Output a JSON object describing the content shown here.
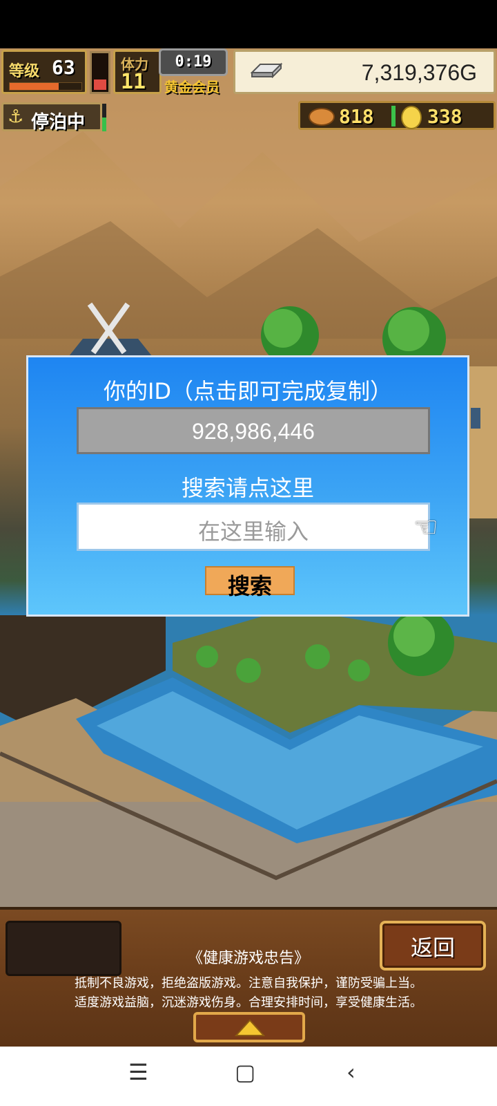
{
  "hud": {
    "level_label": "等级",
    "level_value": "63",
    "exp_fraction": 0.68,
    "stamina_fraction": 0.3,
    "stamina_label": "体力",
    "stamina_value": "11",
    "timer": "0:19",
    "member_label": "黄金会员",
    "gold": "7,319,376G",
    "status_label": "停泊中",
    "food": "818",
    "coins": "338"
  },
  "dialog": {
    "id_heading": "你的ID（点击即可完成复制）",
    "id_value": "928,986,446",
    "search_heading": "搜索请点这里",
    "search_placeholder": "在这里输入",
    "search_button": "搜索"
  },
  "bottom": {
    "back_button": "返回",
    "notice_title": "《健康游戏忠告》",
    "notice_line1": "抵制不良游戏，拒绝盗版游戏。注意自我保护，谨防受骗上当。",
    "notice_line2": "适度游戏益脑，沉迷游戏伤身。合理安排时间，享受健康生活。"
  },
  "navbar": {
    "menu_glyph": "☰",
    "home_glyph": "▢",
    "back_glyph": "‹"
  },
  "colors": {
    "dialog_top": "#1e85f2",
    "dialog_bottom": "#5ec6fb",
    "search_button": "#f0a858",
    "water": "#2f86c6"
  }
}
